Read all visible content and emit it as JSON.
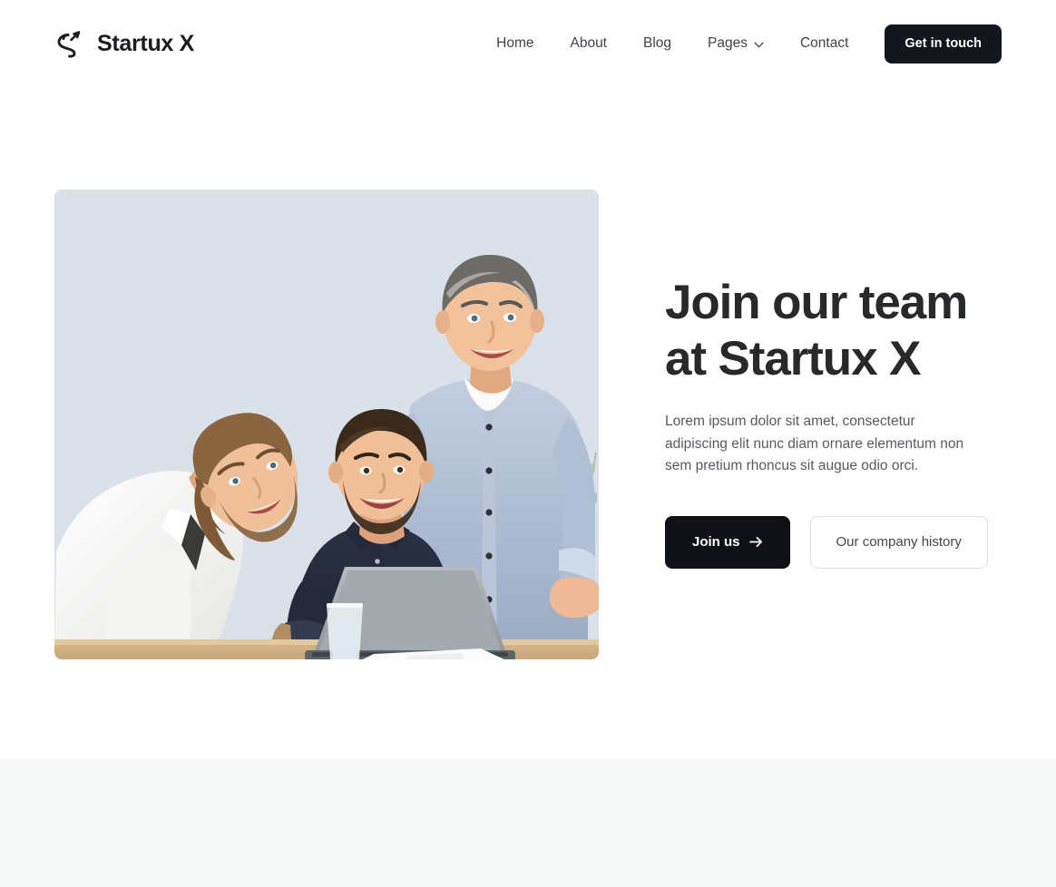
{
  "header": {
    "brand": {
      "name": "Startux X",
      "logo_icon": "swirl-arrow-icon"
    },
    "nav_items": [
      {
        "label": "Home",
        "has_dropdown": false
      },
      {
        "label": "About",
        "has_dropdown": false
      },
      {
        "label": "Blog",
        "has_dropdown": false
      },
      {
        "label": "Pages",
        "has_dropdown": true
      },
      {
        "label": "Contact",
        "has_dropdown": false
      }
    ],
    "cta": {
      "label": "Get in touch",
      "background": "#14161d",
      "text_color": "#ffffff"
    }
  },
  "hero": {
    "image": {
      "alt": "Three smiling businessmen at a desk with a laptop, water glass and coffee cup",
      "background_color": "#dbe1e9"
    },
    "title": "Join our team\nat Startux X",
    "description": "Lorem ipsum dolor sit amet, consectetur adipiscing elit nunc diam ornare elementum non sem pretium rhoncus sit augue odio orci.",
    "primary_button": {
      "label": "Join us",
      "icon": "arrow-right-icon",
      "background": "#0f1116",
      "text_color": "#ffffff"
    },
    "secondary_button": {
      "label": "Our company history",
      "background": "#ffffff",
      "border_color": "#dddfe1",
      "text_color": "#43474d"
    }
  },
  "next_section": {
    "background": "#f7f8f8"
  }
}
